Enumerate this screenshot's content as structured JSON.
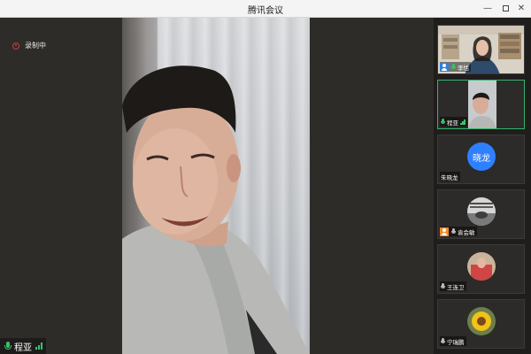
{
  "window": {
    "title": "腾讯会议"
  },
  "recording": {
    "label": "录制中"
  },
  "main_speaker": {
    "name": "程亚"
  },
  "participants": [
    {
      "name": "李恬",
      "host": true,
      "mic": "on"
    },
    {
      "name": "程亚",
      "mic": "on",
      "active": true
    },
    {
      "name": "朱晓龙",
      "avatar_text": "晓龙"
    },
    {
      "name": "袁会敏",
      "host": true,
      "mic": "muted"
    },
    {
      "name": "王连卫",
      "mic": "muted"
    },
    {
      "name": "宁瑞鹏",
      "mic": "muted"
    }
  ],
  "colors": {
    "accent_green": "#33b46b",
    "host_blue": "#2f7fe0",
    "cohost_orange": "#f08b2b",
    "recording_red": "#d23b3b",
    "avatar_blue": "#2f80ff"
  },
  "icons": [
    "record-icon",
    "mic-icon",
    "signal-icon",
    "host-icon",
    "minimize-icon",
    "maximize-icon",
    "close-icon"
  ]
}
